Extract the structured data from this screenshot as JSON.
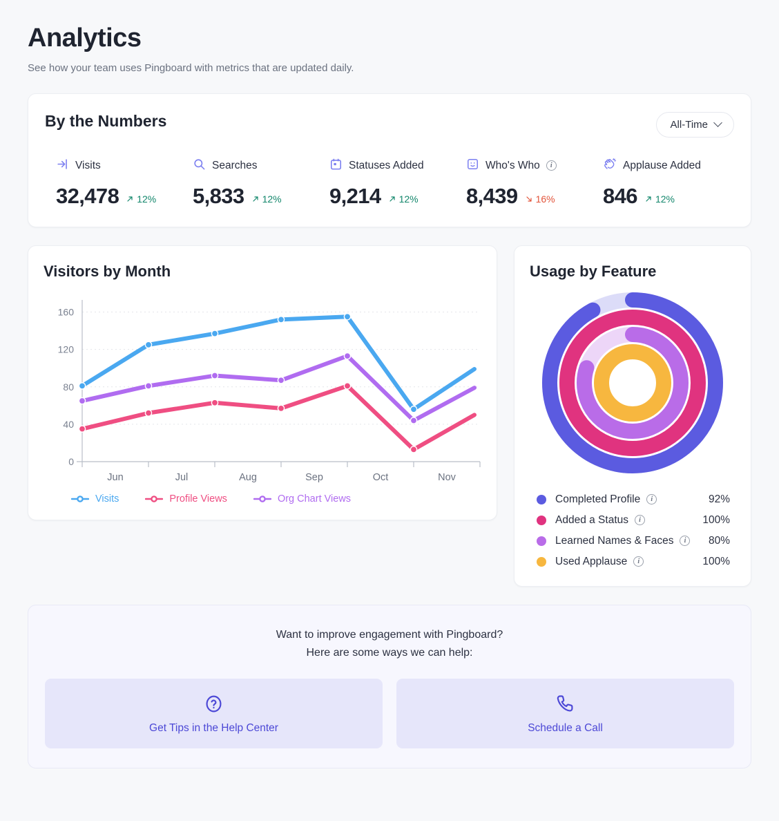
{
  "header": {
    "title": "Analytics",
    "subtitle": "See how your team uses Pingboard with metrics that are updated daily."
  },
  "numbers": {
    "title": "By the Numbers",
    "timeframe": {
      "label": "All-Time",
      "icon": "chevron-down-icon"
    },
    "stats": [
      {
        "icon": "login-arrow-icon",
        "label": "Visits",
        "value": "32,478",
        "delta": "12%",
        "direction": "up",
        "has_info": false
      },
      {
        "icon": "search-icon",
        "label": "Searches",
        "value": "5,833",
        "delta": "12%",
        "direction": "up",
        "has_info": false
      },
      {
        "icon": "calendar-icon",
        "label": "Statuses Added",
        "value": "9,214",
        "delta": "12%",
        "direction": "up",
        "has_info": false
      },
      {
        "icon": "face-card-icon",
        "label": "Who's Who",
        "value": "8,439",
        "delta": "16%",
        "direction": "down",
        "has_info": true
      },
      {
        "icon": "applause-icon",
        "label": "Applause Added",
        "value": "846",
        "delta": "12%",
        "direction": "up",
        "has_info": false
      }
    ],
    "colors": {
      "up": "#12866b",
      "down": "#e2543a",
      "icon": "#7b7ff0"
    }
  },
  "chart_data": [
    {
      "type": "line",
      "title": "Visitors by Month",
      "xlabel": "",
      "ylabel": "",
      "categories": [
        "Jun",
        "Jul",
        "Aug",
        "Sep",
        "Oct",
        "Nov"
      ],
      "yticks": [
        0,
        40,
        80,
        120,
        160
      ],
      "ylim": [
        0,
        170
      ],
      "grid": true,
      "legend_position": "bottom",
      "series": [
        {
          "name": "Visits",
          "color": "#4aa8f0",
          "values": [
            81,
            125,
            137,
            152,
            155,
            56
          ],
          "tail_value": 99
        },
        {
          "name": "Profile Views",
          "color": "#ef4e82",
          "values": [
            35,
            52,
            63,
            57,
            81,
            13
          ],
          "tail_value": 50
        },
        {
          "name": "Org Chart Views",
          "color": "#b06cf0",
          "values": [
            65,
            81,
            92,
            87,
            113,
            44
          ],
          "tail_value": 79
        }
      ]
    },
    {
      "type": "pie",
      "subtype": "multi-ring-radial",
      "title": "Usage by Feature",
      "categories": [
        "Completed Profile",
        "Added a Status",
        "Learned Names & Faces",
        "Used Applause"
      ],
      "values": [
        92,
        100,
        80,
        100
      ],
      "value_labels": [
        "92%",
        "100%",
        "80%",
        "100%"
      ],
      "colors": [
        "#5b5be0",
        "#e0337f",
        "#b96ce8",
        "#f7b73f"
      ],
      "track_colors": [
        "#dcdcf8",
        "#fbd6e6",
        "#edd6f8",
        "#fceed1"
      ],
      "legend_position": "bottom",
      "legend_has_info_icons": [
        true,
        true,
        true,
        true
      ]
    }
  ],
  "help": {
    "line1": "Want to improve engagement with Pingboard?",
    "line2": "Here are some ways we can help:",
    "buttons": [
      {
        "icon": "question-circle-icon",
        "label": "Get Tips in the Help Center"
      },
      {
        "icon": "phone-icon",
        "label": "Schedule a Call"
      }
    ],
    "accent": "#4c48d6"
  }
}
